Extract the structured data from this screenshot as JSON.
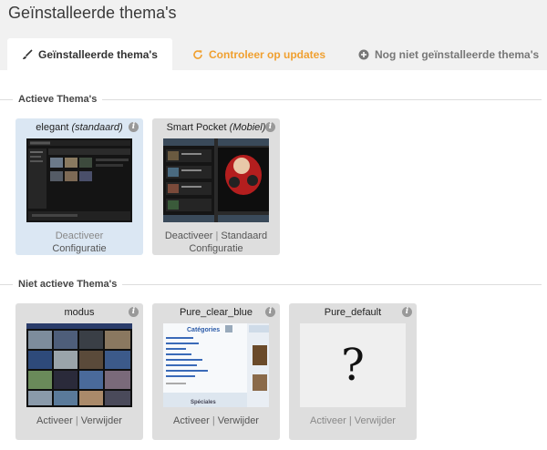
{
  "page": {
    "title": "Geïnstalleerde thema's"
  },
  "tabs": [
    {
      "label": "Geïnstalleerde thema's"
    },
    {
      "label": "Controleer op updates"
    },
    {
      "label": "Nog niet geïnstalleerde thema's"
    }
  ],
  "sections": {
    "active": {
      "title": "Actieve Thema's"
    },
    "inactive": {
      "title": "Niet actieve Thema's"
    }
  },
  "active_themes": [
    {
      "name": "elegant",
      "tag": "(standaard)",
      "action1": "Deactiveer",
      "action2": "Configuratie"
    },
    {
      "name": "Smart Pocket",
      "tag": "(Mobiel)",
      "action1": "Deactiveer",
      "separator": "|",
      "action1b": "Standaard",
      "action2": "Configuratie"
    }
  ],
  "inactive_themes": [
    {
      "name": "modus",
      "activate": "Activeer",
      "separator": "|",
      "delete": "Verwijder"
    },
    {
      "name": "Pure_clear_blue",
      "activate": "Activeer",
      "separator": "|",
      "delete": "Verwijder",
      "preview_heading": "Catégories",
      "preview_footer": "Spéciales"
    },
    {
      "name": "Pure_default",
      "activate": "Activeer",
      "separator": "|",
      "delete": "Verwijder",
      "placeholder": "?"
    }
  ],
  "colors": {
    "accent": "#f0a030",
    "active_card": "#dbe7f3",
    "card": "#dedede",
    "header_bg": "#f1f1f1"
  },
  "icons": {
    "tab1": "brush-icon",
    "tab2": "refresh-icon",
    "tab3": "plus-circle-icon",
    "info": "info-icon"
  }
}
